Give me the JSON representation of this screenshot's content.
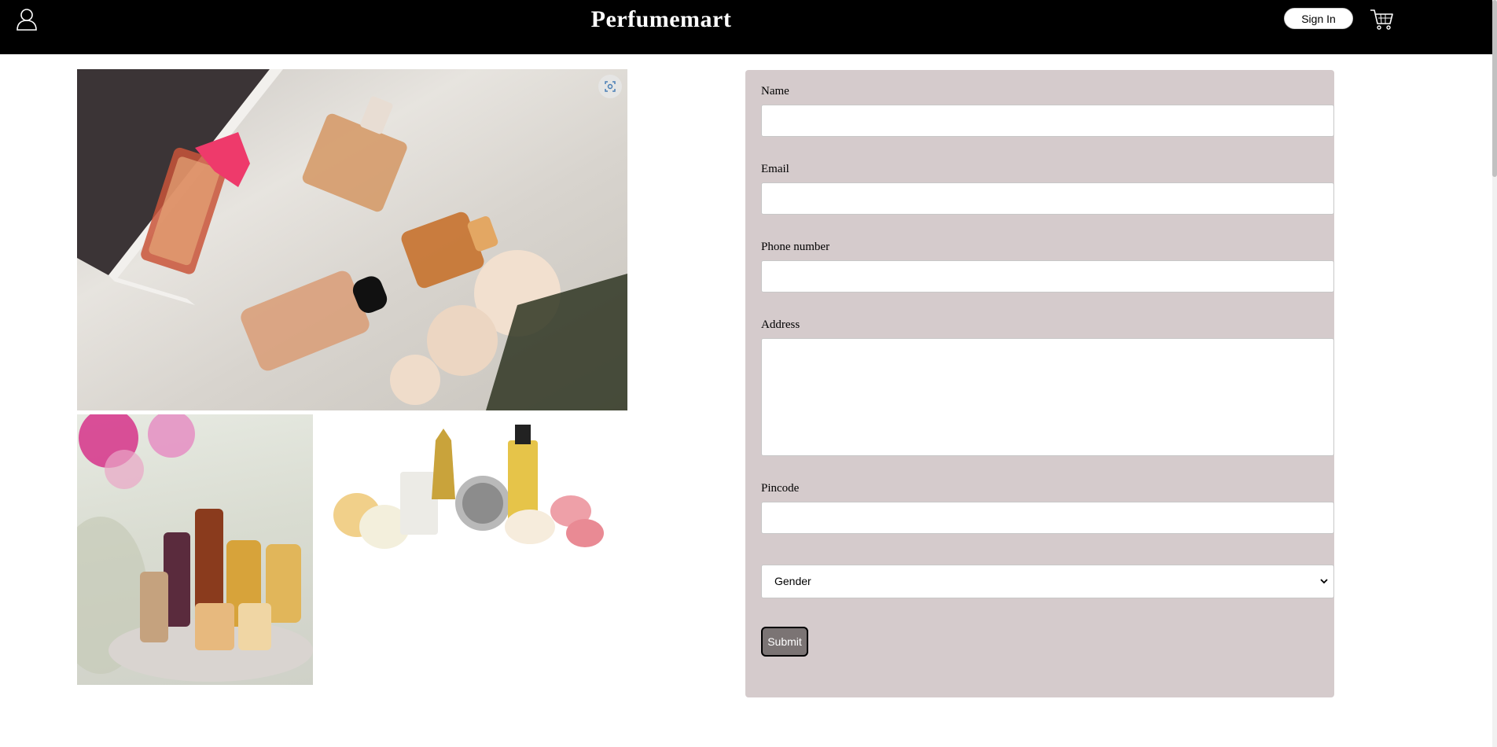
{
  "header": {
    "brand": "Perfumemart",
    "sign_in_label": "Sign In",
    "user_icon": "user-icon",
    "cart_icon": "cart-icon",
    "background": "#000000"
  },
  "gallery": {
    "images": [
      {
        "name": "perfume-bottles-on-bedsheet-photo"
      },
      {
        "name": "perfume-tray-with-flowers-photo"
      },
      {
        "name": "perfume-bottles-with-flowers-photo"
      }
    ],
    "lens_icon": "visual-search-icon"
  },
  "form": {
    "background": "#d5cbcc",
    "name_label": "Name",
    "email_label": "Email",
    "phone_label": "Phone number",
    "address_label": "Address",
    "pincode_label": "Pincode",
    "name_value": "",
    "email_value": "",
    "phone_value": "",
    "address_value": "",
    "pincode_value": "",
    "gender_selected": "Gender",
    "submit_label": "Submit"
  }
}
